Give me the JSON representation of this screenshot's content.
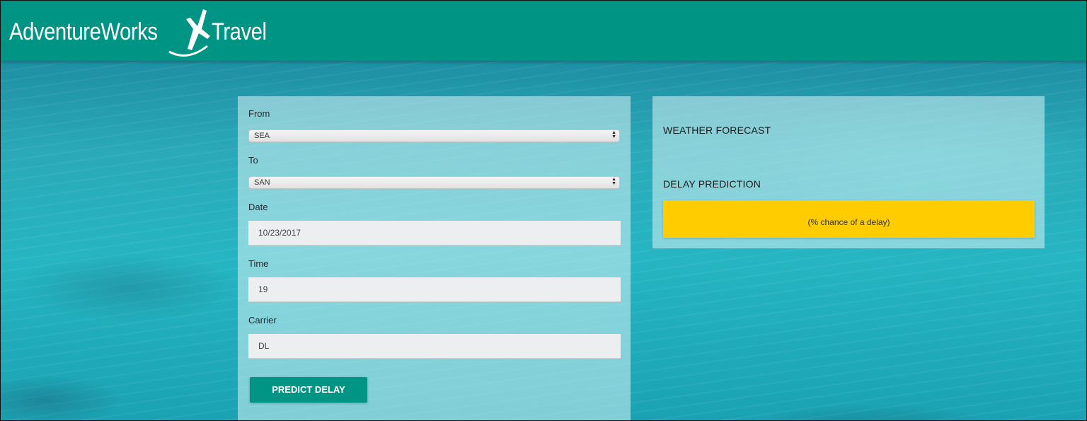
{
  "header": {
    "logo_part1": "AdventureWorks",
    "logo_part2": "Travel",
    "logo_icon": "airplane-icon",
    "background_color": "#009485"
  },
  "form": {
    "from_label": "From",
    "from_value": "SEA",
    "to_label": "To",
    "to_value": "SAN",
    "date_label": "Date",
    "date_value": "10/23/2017",
    "time_label": "Time",
    "time_value": "19",
    "carrier_label": "Carrier",
    "carrier_value": "DL",
    "submit_label": "PREDICT DELAY"
  },
  "results": {
    "weather_title": "WEATHER FORECAST",
    "delay_title": "DELAY PREDICTION",
    "delay_placeholder": "(% chance of a delay)",
    "delay_color": "#ffcc00"
  }
}
